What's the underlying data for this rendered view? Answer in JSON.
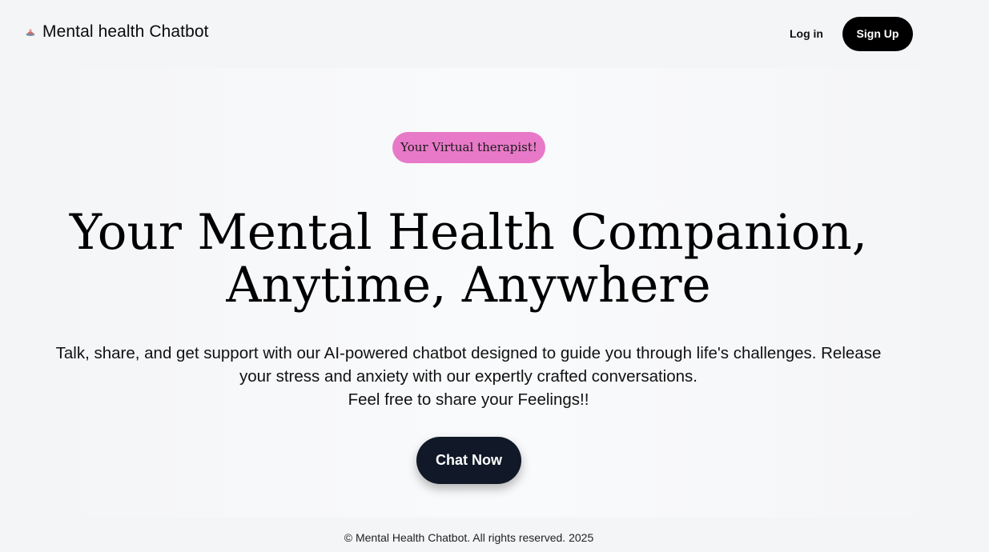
{
  "header": {
    "brand_title": "Mental health Chatbot",
    "brand_icon": "chatbot-logo-icon",
    "login_label": "Log in",
    "signup_label": "Sign Up"
  },
  "hero": {
    "badge": "Your Virtual therapist!",
    "headline_line1": "Your Mental Health Companion,",
    "headline_line2": "Anytime, Anywhere",
    "subtitle_line1": "Talk, share, and get support with our AI-powered chatbot designed to guide you through life's challenges. Release",
    "subtitle_line2": "your stress and anxiety with our expertly crafted conversations.",
    "subtitle_line3": "Feel free to share your Feelings!!",
    "cta_label": "Chat Now"
  },
  "footer": {
    "copyright": "© Mental Health Chatbot. All rights reserved. 2025"
  },
  "colors": {
    "badge_bg": "#e879c8",
    "signup_bg": "#000000",
    "cta_bg": "#111827",
    "page_bg": "#f4f5f7"
  }
}
